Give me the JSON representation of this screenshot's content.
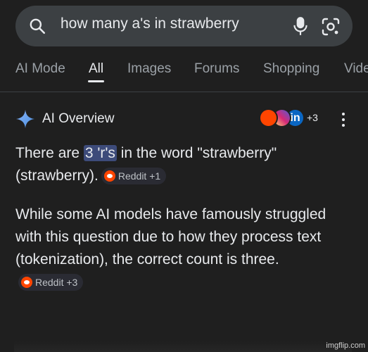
{
  "search": {
    "query": "how many a's in strawberry"
  },
  "tabs": [
    {
      "label": "AI Mode"
    },
    {
      "label": "All"
    },
    {
      "label": "Images"
    },
    {
      "label": "Forums"
    },
    {
      "label": "Shopping"
    },
    {
      "label": "Vide"
    }
  ],
  "overview": {
    "title": "AI Overview",
    "sources_more": "+3",
    "para1": {
      "pre": "There are ",
      "highlight": "3 'r's",
      "post": " in the word \"strawberry\" (strawberry).",
      "chip": "Reddit +1"
    },
    "para2": {
      "text": "While some AI models have famously struggled with this question due to how they process text (tokenization), the correct count is three.",
      "chip": "Reddit +3"
    }
  },
  "watermark": "imgflip.com",
  "colors": {
    "background": "#1f1f1f",
    "search_bar": "#3c4043",
    "highlight": "#3d4b7a",
    "sparkle": "#4a90e2"
  }
}
